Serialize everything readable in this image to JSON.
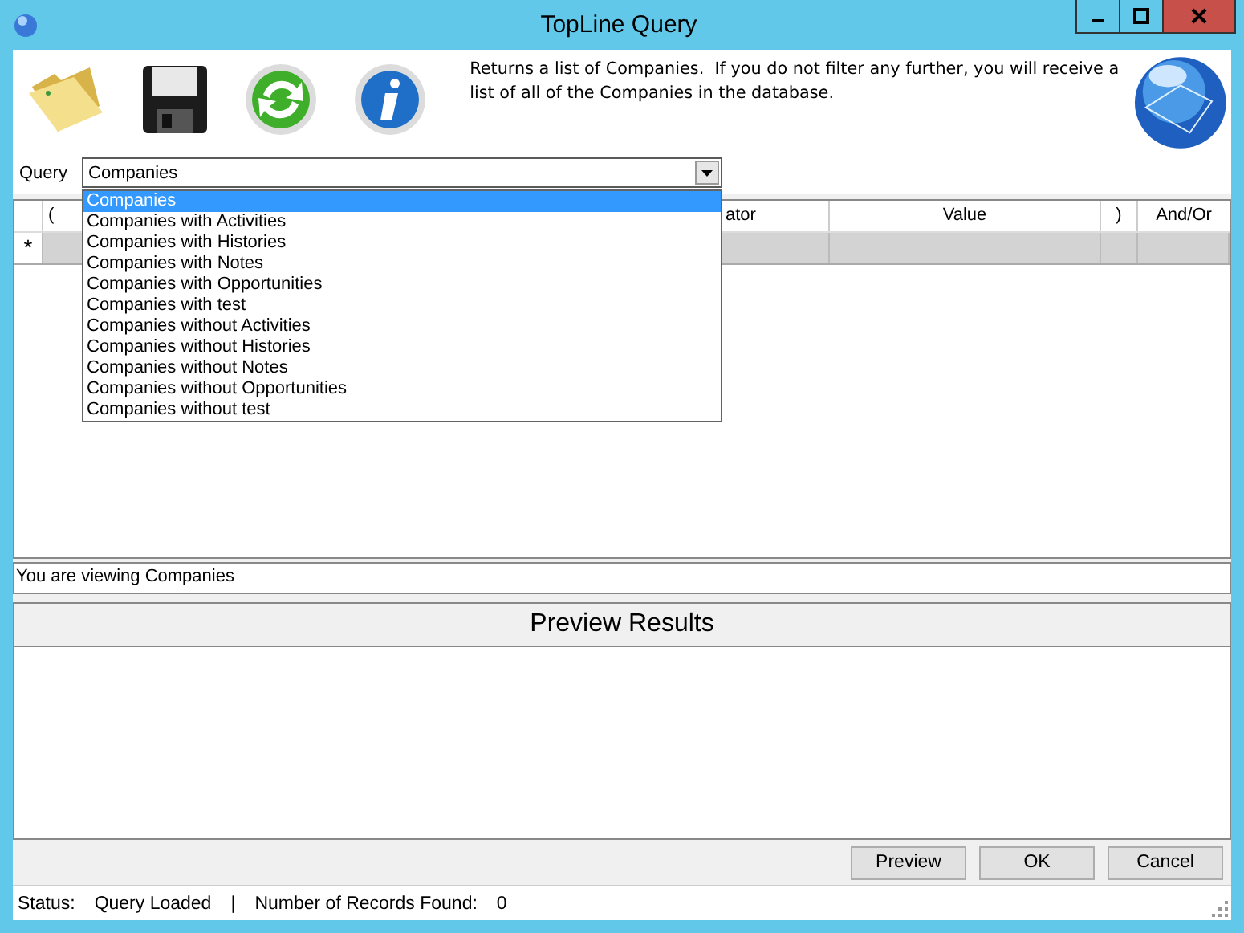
{
  "window": {
    "title": "TopLine Query"
  },
  "toolbar": {
    "description": "Returns a list of Companies.  If you do not filter any further, you will receive a list of all of the Companies in the database."
  },
  "query": {
    "label": "Query",
    "value": "Companies",
    "expanded": true,
    "options": [
      {
        "label": "Companies",
        "selected": true
      },
      {
        "label": "Companies with Activities",
        "selected": false
      },
      {
        "label": "Companies with Histories",
        "selected": false
      },
      {
        "label": "Companies with Notes",
        "selected": false
      },
      {
        "label": "Companies with Opportunities",
        "selected": false
      },
      {
        "label": "Companies with test",
        "selected": false
      },
      {
        "label": "Companies without Activities",
        "selected": false
      },
      {
        "label": "Companies without Histories",
        "selected": false
      },
      {
        "label": "Companies without Notes",
        "selected": false
      },
      {
        "label": "Companies without Opportunities",
        "selected": false
      },
      {
        "label": "Companies without test",
        "selected": false
      }
    ]
  },
  "grid": {
    "columns": [
      "(",
      "ator",
      "Value",
      ")",
      "And/Or"
    ],
    "new_row_marker": "*"
  },
  "view_note": "You are viewing Companies",
  "preview": {
    "title": "Preview Results"
  },
  "buttons": [
    "Preview",
    "OK",
    "Cancel"
  ],
  "status": {
    "label": "Status:",
    "state": "Query Loaded",
    "separator": "|",
    "records_label": "Number of Records Found:",
    "records": "0"
  }
}
